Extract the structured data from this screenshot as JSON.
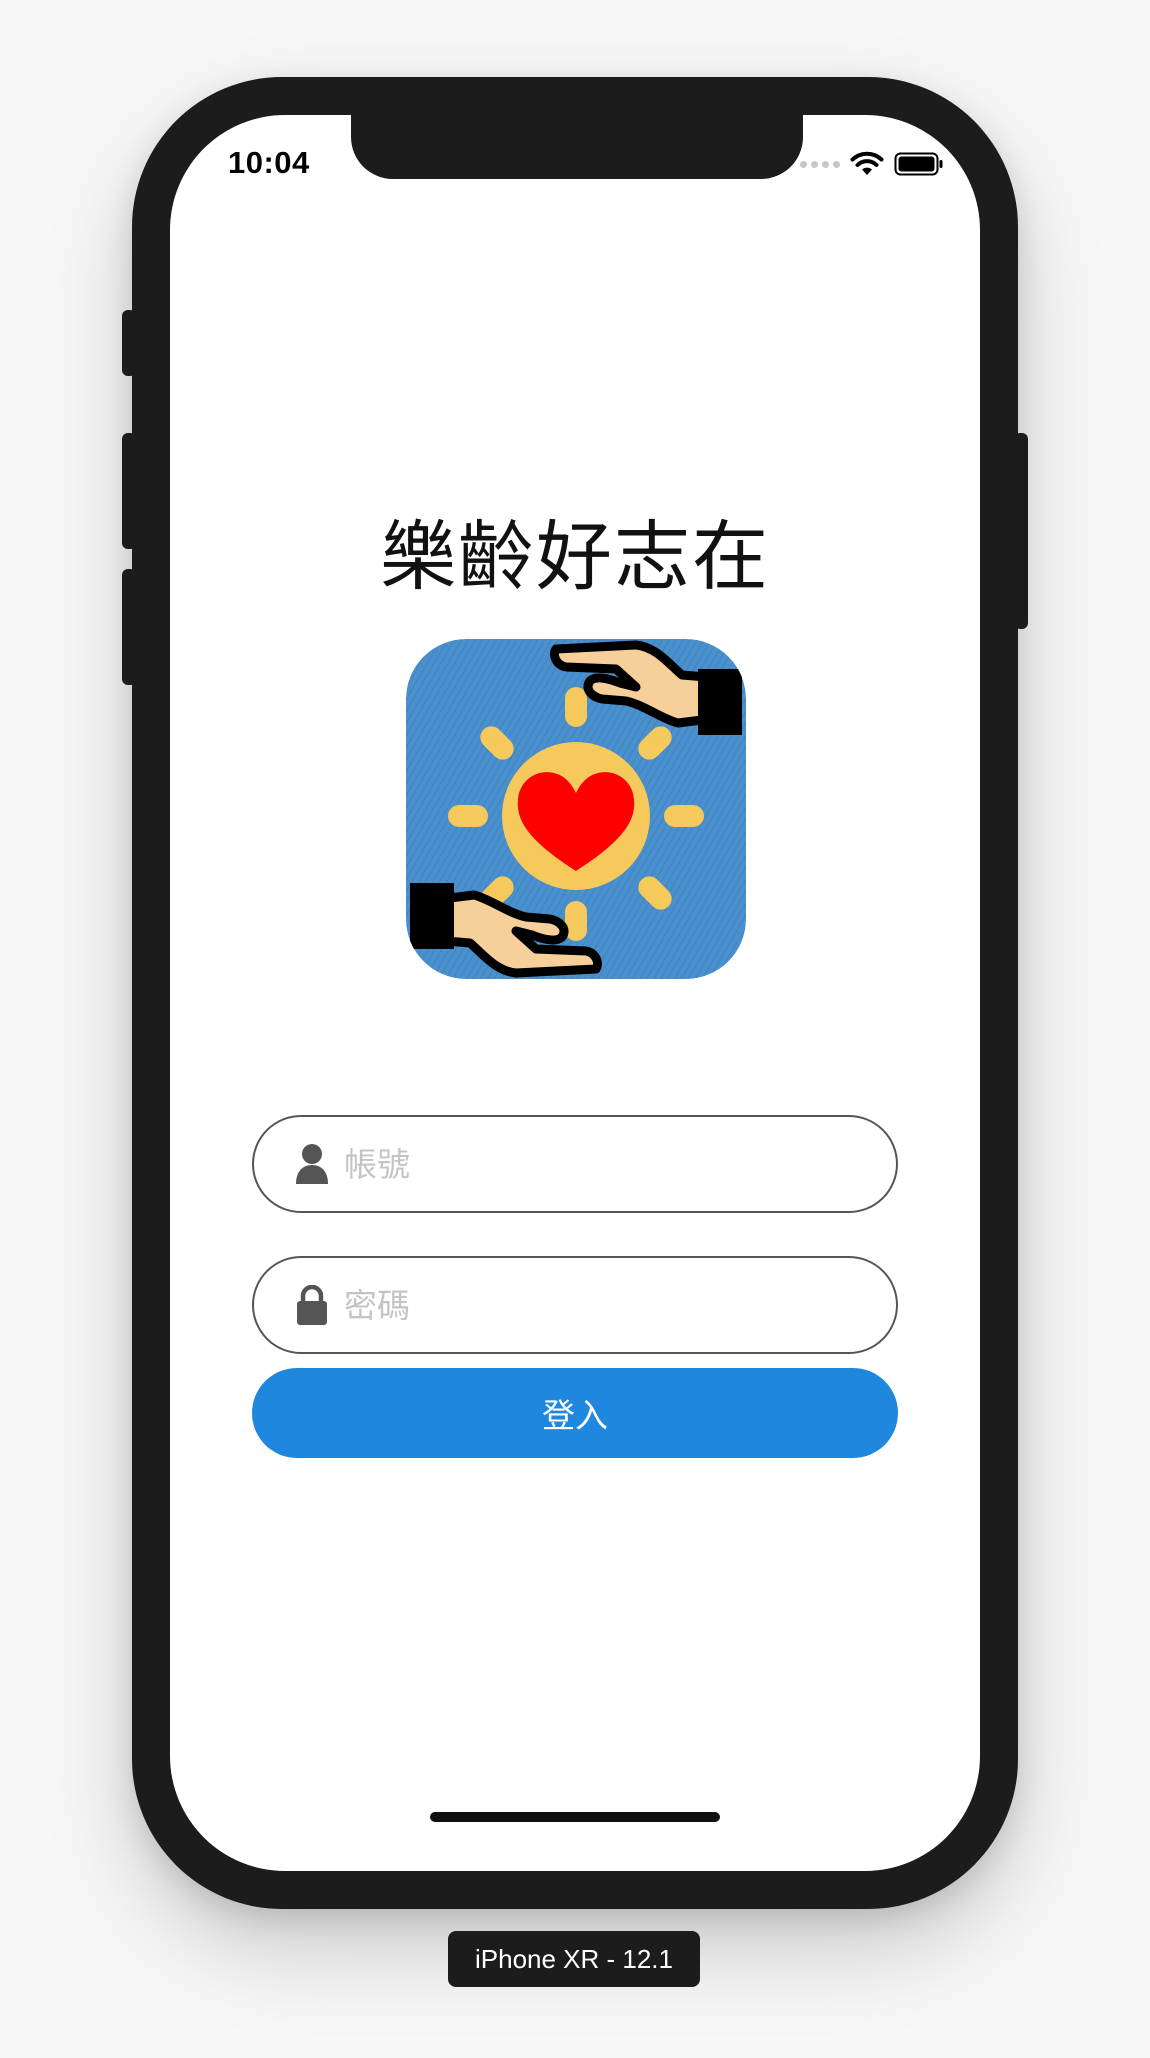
{
  "status_bar": {
    "time": "10:04",
    "icons": [
      "signal-icon",
      "wifi-icon",
      "battery-icon"
    ]
  },
  "app": {
    "title": "樂齡好志在",
    "logo_icon": "sun-heart-hands-logo"
  },
  "form": {
    "account": {
      "icon": "user-icon",
      "placeholder": "帳號",
      "value": ""
    },
    "password": {
      "icon": "lock-icon",
      "placeholder": "密碼",
      "value": ""
    },
    "login_label": "登入"
  },
  "simulator": {
    "device_label": "iPhone XR - 12.1"
  },
  "colors": {
    "accent": "#1f87de",
    "logo_bg": "#4a90cc",
    "sun": "#f5c95c",
    "heart": "#ff0000",
    "hand_skin": "#f6cf9a"
  }
}
